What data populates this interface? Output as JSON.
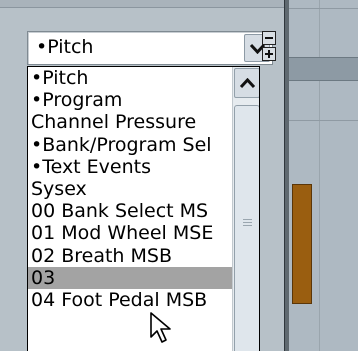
{
  "combo": {
    "selected_value": "•Pitch",
    "button_icon": "chevron-down-icon"
  },
  "controls": {
    "minus_icon": "minus-icon",
    "plus_icon": "plus-icon"
  },
  "dropdown": {
    "items": [
      "•Pitch",
      "•Program",
      "Channel Pressure",
      "•Bank/Program Sel",
      "•Text Events",
      "Sysex",
      "00 Bank Select MS",
      "01 Mod Wheel MSE",
      "02 Breath MSB",
      "03",
      "04 Foot Pedal MSB"
    ],
    "highlighted": "03",
    "scroll_up_icon": "chevron-up-icon"
  },
  "colors": {
    "highlight": "#a3a3a3",
    "event_bar": "#9a5e10"
  }
}
